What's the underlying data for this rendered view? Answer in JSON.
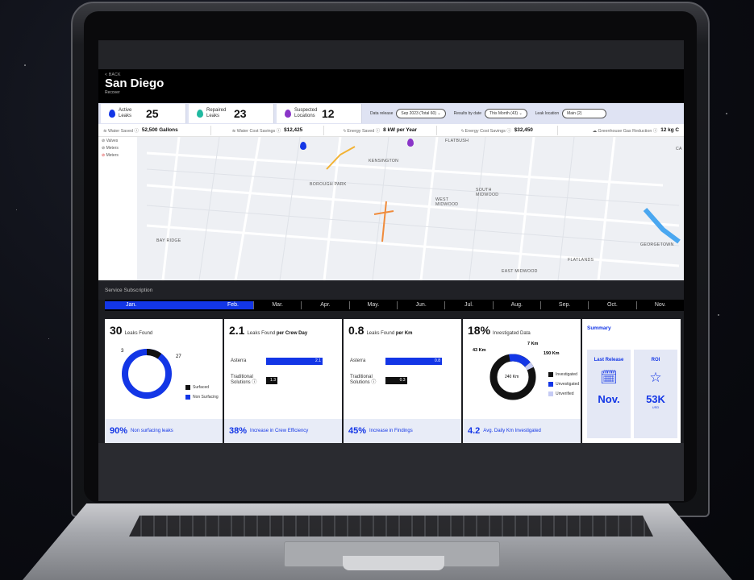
{
  "header": {
    "back_label": "< BACK",
    "title": "San Diego",
    "subtitle": "Recover"
  },
  "stats": [
    {
      "label": "Active Leaks",
      "value": "25",
      "color": "#1336e6"
    },
    {
      "label": "Repaired Leaks",
      "value": "23",
      "color": "#20b9a0"
    },
    {
      "label": "Suspected Locations",
      "value": "12",
      "color": "#8a35c8"
    }
  ],
  "filters": {
    "data_release_label": "Data release",
    "data_release_value": "Sep 2023 (Total 60) ⌄",
    "results_label": "Results by date",
    "results_value": "This Month (43) ⌄",
    "location_label": "Leak location",
    "location_value": "Main (2)"
  },
  "metrics": [
    {
      "label": "≋ Water Saved ⓘ",
      "value": "52,500 Gallons"
    },
    {
      "label": "≋ Water Cost Savings ⓘ",
      "value": "$12,425"
    },
    {
      "label": "ϟ Energy Saved ⓘ",
      "value": "8 kW per Year"
    },
    {
      "label": "ϟ Energy Cost Savings ⓘ",
      "value": "$32,450"
    },
    {
      "label": "☁ Greenhouse Gas Reduction ⓘ",
      "value": "12 kg C"
    }
  ],
  "map": {
    "legend": [
      "Valves",
      "Meters",
      "Meters"
    ],
    "labels": [
      "FLATBUSH",
      "KENSINGTON",
      "BOROUGH PARK",
      "WEST MIDWOOD",
      "SOUTH MIDWOOD",
      "BAY RIDGE",
      "GEORGETOWN",
      "FLATLANDS",
      "EAST MIDWOOD",
      "CA"
    ]
  },
  "service": {
    "label": "Service Subscription",
    "months": [
      "Jan.",
      "Feb.",
      "Mar.",
      "Apr.",
      "May.",
      "Jun.",
      "Jul.",
      "Aug.",
      "Sep.",
      "Oct.",
      "Nov."
    ]
  },
  "cards": {
    "leaks": {
      "big": "30",
      "label": "Leaks Found",
      "v1": "3",
      "v2": "27",
      "legend_surfaced": "Surfaced",
      "legend_nonsurfacing": "Non Surfacing",
      "foot_big": "90%",
      "foot_text": "Non surfacing leaks",
      "fraction_nonsurfacing": 0.9
    },
    "crew": {
      "big": "2.1",
      "label_pre": "Leaks Found ",
      "label_bold": "per Crew Day",
      "row1": "Asterra",
      "row1_val": "2.1",
      "row1_fraction": 1.0,
      "row2": "Traditional Solutions ⓘ",
      "row2_val": "1.3",
      "row2_fraction": 0.2,
      "foot_big": "38%",
      "foot_text": "Increase in Crew Efficiency"
    },
    "km": {
      "big": "0.8",
      "label_pre": "Leaks Found ",
      "label_bold": "per Km",
      "row1": "Asterra",
      "row1_val": "0.8",
      "row1_fraction": 1.0,
      "row2": "Traditional Solutions ⓘ",
      "row2_val": "0.3",
      "row2_fraction": 0.38,
      "foot_big": "45%",
      "foot_text": "Increase in Findings"
    },
    "investigated": {
      "big": "18%",
      "label": "Investigated Data",
      "l1": "43 Km",
      "l2": "7 Km",
      "l3": "190 Km",
      "center": "240 Km",
      "legend": [
        "Investigated",
        "Unvestigated",
        "Unverified"
      ],
      "foot_big": "4.2",
      "foot_text": "Avg. Daily Km Investigated"
    }
  },
  "summary": {
    "title": "Summary",
    "release_label": "Last Release",
    "release_value": "Nov.",
    "roi_label": "ROI",
    "roi_value": "53K",
    "roi_unit": "USD"
  }
}
